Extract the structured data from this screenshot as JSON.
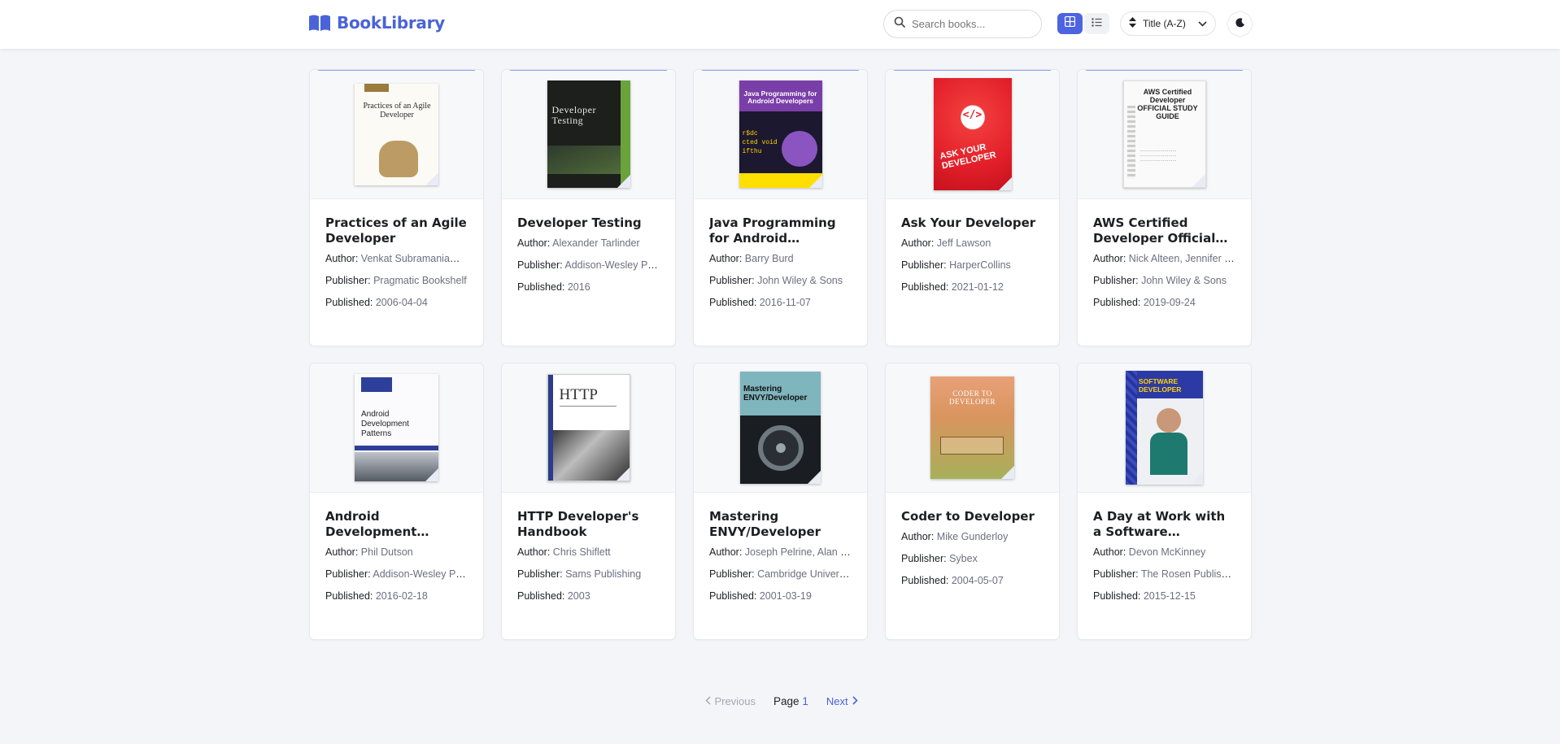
{
  "header": {
    "logo_text": "BookLibrary",
    "search_placeholder": "Search books...",
    "sort_label": "Title (A-Z)",
    "accent_color": "#4a63d8"
  },
  "books": [
    {
      "title": "Practices of an Agile Developer",
      "author": "Venkat Subramaniam, Andy Hunt",
      "publisher": "Pragmatic Bookshelf",
      "published": "2006-04-04",
      "cover_text": "Practices of an Agile Developer"
    },
    {
      "title": "Developer Testing",
      "author": "Alexander Tarlinder",
      "publisher": "Addison-Wesley Professional",
      "published": "2016",
      "cover_text": "Developer Testing"
    },
    {
      "title": "Java Programming for Android Developers For Dummies",
      "author": "Barry Burd",
      "publisher": "John Wiley & Sons",
      "published": "2016-11-07",
      "cover_text": "Java Programming for Android Developers"
    },
    {
      "title": "Ask Your Developer",
      "author": "Jeff Lawson",
      "publisher": "HarperCollins",
      "published": "2021-01-12",
      "cover_text": "ASK YOUR DEVELOPER"
    },
    {
      "title": "AWS Certified Developer Official Study Guide",
      "author": "Nick Alteen, Jennifer Fisher",
      "publisher": "John Wiley & Sons",
      "published": "2019-09-24",
      "cover_text": "AWS Certified Developer OFFICIAL STUDY GUIDE"
    },
    {
      "title": "Android Development Patterns",
      "author": "Phil Dutson",
      "publisher": "Addison-Wesley Professional",
      "published": "2016-02-18",
      "cover_text": "Android Development Patterns"
    },
    {
      "title": "HTTP Developer's Handbook",
      "author": "Chris Shiflett",
      "publisher": "Sams Publishing",
      "published": "2003",
      "cover_text": "HTTP"
    },
    {
      "title": "Mastering ENVY/Developer",
      "author": "Joseph Pelrine, Alan Knight",
      "publisher": "Cambridge University Press",
      "published": "2001-03-19",
      "cover_text": "Mastering ENVY/Developer"
    },
    {
      "title": "Coder to Developer",
      "author": "Mike Gunderloy",
      "publisher": "Sybex",
      "published": "2004-05-07",
      "cover_text": "CODER TO DEVELOPER"
    },
    {
      "title": "A Day at Work with a Software Developer",
      "author": "Devon McKinney",
      "publisher": "The Rosen Publishing Group",
      "published": "2015-12-15",
      "cover_text": "SOFTWARE DEVELOPER"
    }
  ],
  "labels": {
    "author": "Author:",
    "publisher": "Publisher:",
    "published": "Published:"
  },
  "pagination": {
    "prev": "Previous",
    "page_label": "Page",
    "page_number": "1",
    "next": "Next"
  }
}
